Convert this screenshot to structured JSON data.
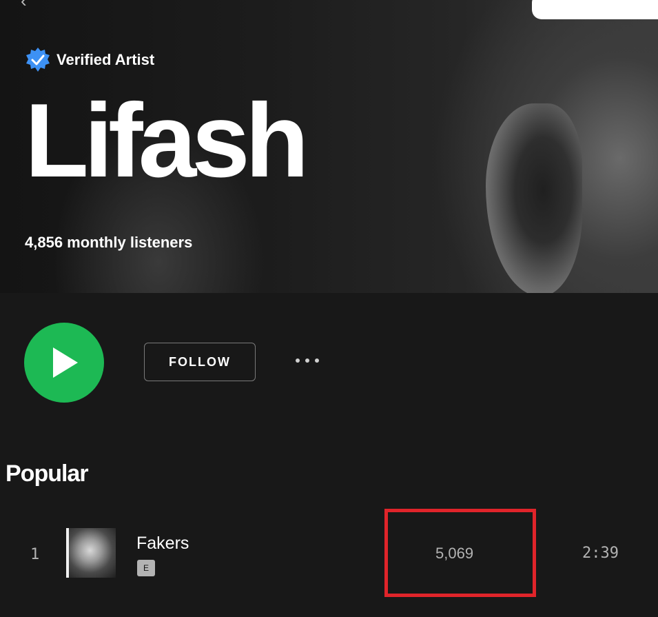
{
  "artist": {
    "verified_label": "Verified Artist",
    "name": "Lifash",
    "monthly_listeners": "4,856 monthly listeners"
  },
  "actions": {
    "follow_label": "FOLLOW",
    "play_color": "#1db954"
  },
  "popular": {
    "title": "Popular",
    "tracks": [
      {
        "index": "1",
        "title": "Fakers",
        "explicit": "E",
        "plays": "5,069",
        "duration": "2:39"
      }
    ]
  },
  "colors": {
    "accent": "#1db954",
    "verified_badge": "#3d91f4",
    "highlight": "#e0242a",
    "background": "#181818"
  }
}
